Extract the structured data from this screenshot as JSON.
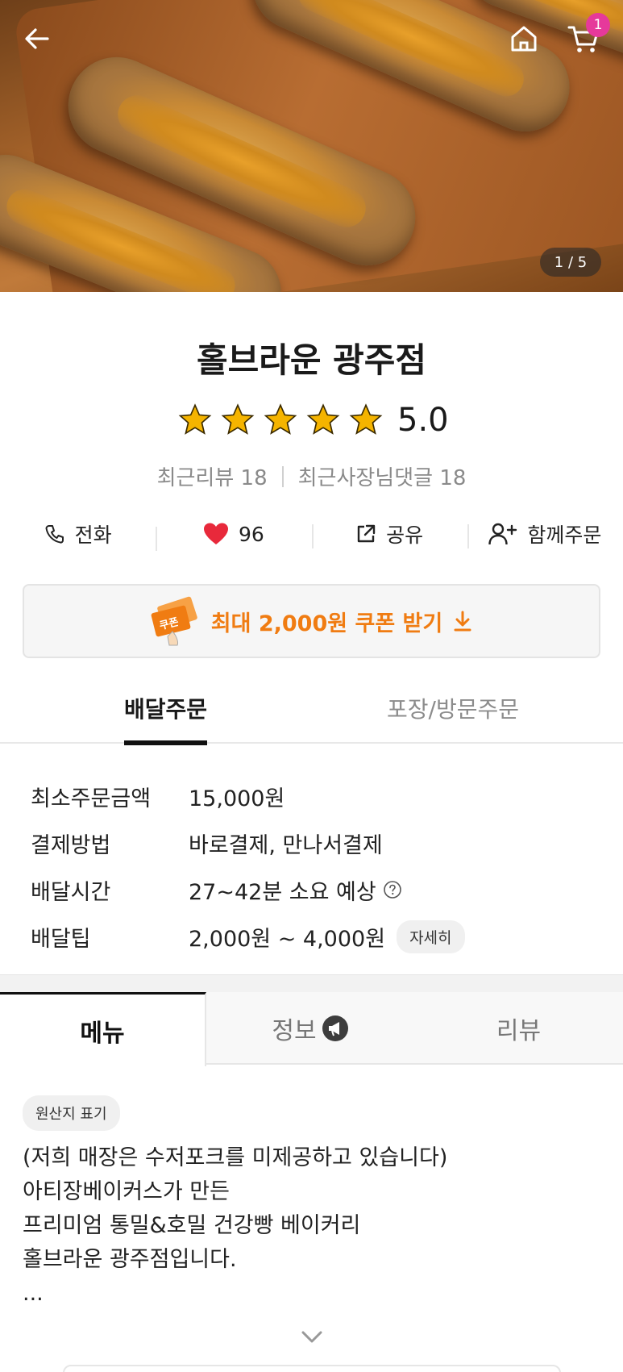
{
  "hero": {
    "image_counter": "1 / 5",
    "cart_count": "1",
    "icons": {
      "back": "arrow-left-icon",
      "home": "home-icon",
      "cart": "cart-icon"
    }
  },
  "store": {
    "name": "홀브라운 광주점",
    "stars": 5,
    "rating": "5.0",
    "recent_reviews": "최근리뷰 18",
    "recent_owner_replies": "최근사장님댓글 18"
  },
  "actions": {
    "call": "전화",
    "likes": "96",
    "share": "공유",
    "group_order": "함께주문"
  },
  "coupon": {
    "label": "최대 2,000원 쿠폰 받기",
    "ticket_text": "쿠폰",
    "accent_color": "#f07c12"
  },
  "order_tabs": {
    "delivery": "배달주문",
    "pickup": "포장/방문주문"
  },
  "info": [
    {
      "label": "최소주문금액",
      "value": "15,000원"
    },
    {
      "label": "결제방법",
      "value": "바로결제, 만나서결제"
    },
    {
      "label": "배달시간",
      "value": "27~42분 소요 예상"
    },
    {
      "label": "배달팁",
      "value": "2,000원 ~ 4,000원",
      "chip": "자세히"
    }
  ],
  "main_tabs": {
    "menu": "메뉴",
    "info": "정보",
    "review": "리뷰"
  },
  "origin_chip": "원산지 표기",
  "description": [
    "(저희 매장은 수저포크를 미제공하고 있습니다)",
    "아티장베이커스가 만든",
    "프리미엄 통밀&호밀 건강빵 베이커리",
    "홀브라운 광주점입니다.",
    "..."
  ],
  "colors": {
    "star": "#f5b400",
    "heart": "#e8293b",
    "badge": "#e6399b"
  }
}
